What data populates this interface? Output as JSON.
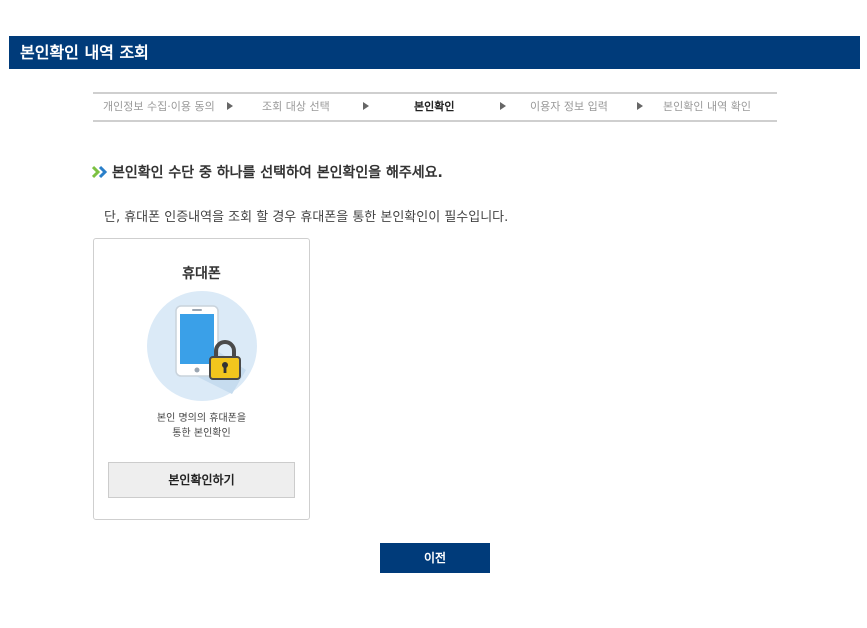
{
  "page": {
    "title": "본인확인 내역 조회"
  },
  "steps": [
    {
      "label": "개인정보 수집·이용 동의",
      "active": false
    },
    {
      "label": "조회 대상 선택",
      "active": false
    },
    {
      "label": "본인확인",
      "active": true
    },
    {
      "label": "이용자 정보 입력",
      "active": false
    },
    {
      "label": "본인확인 내역 확인",
      "active": false
    }
  ],
  "instruction": {
    "headline": "본인확인 수단 중 하나를 선택하여 본인확인을 해주세요.",
    "note": "단, 휴대폰 인증내역을 조회 할 경우 휴대폰을 통한 본인확인이 필수입니다."
  },
  "method_card": {
    "title": "휴대폰",
    "icon": "phone-lock-icon",
    "desc_line1": "본인 명의의 휴대폰을",
    "desc_line2": "통한 본인확인",
    "button_label": "본인확인하기"
  },
  "footer": {
    "prev_label": "이전"
  },
  "colors": {
    "primary": "#003b7a",
    "chevron_green": "#7cc142",
    "chevron_blue": "#2a7fc9",
    "lock_yellow": "#f3c61d"
  }
}
